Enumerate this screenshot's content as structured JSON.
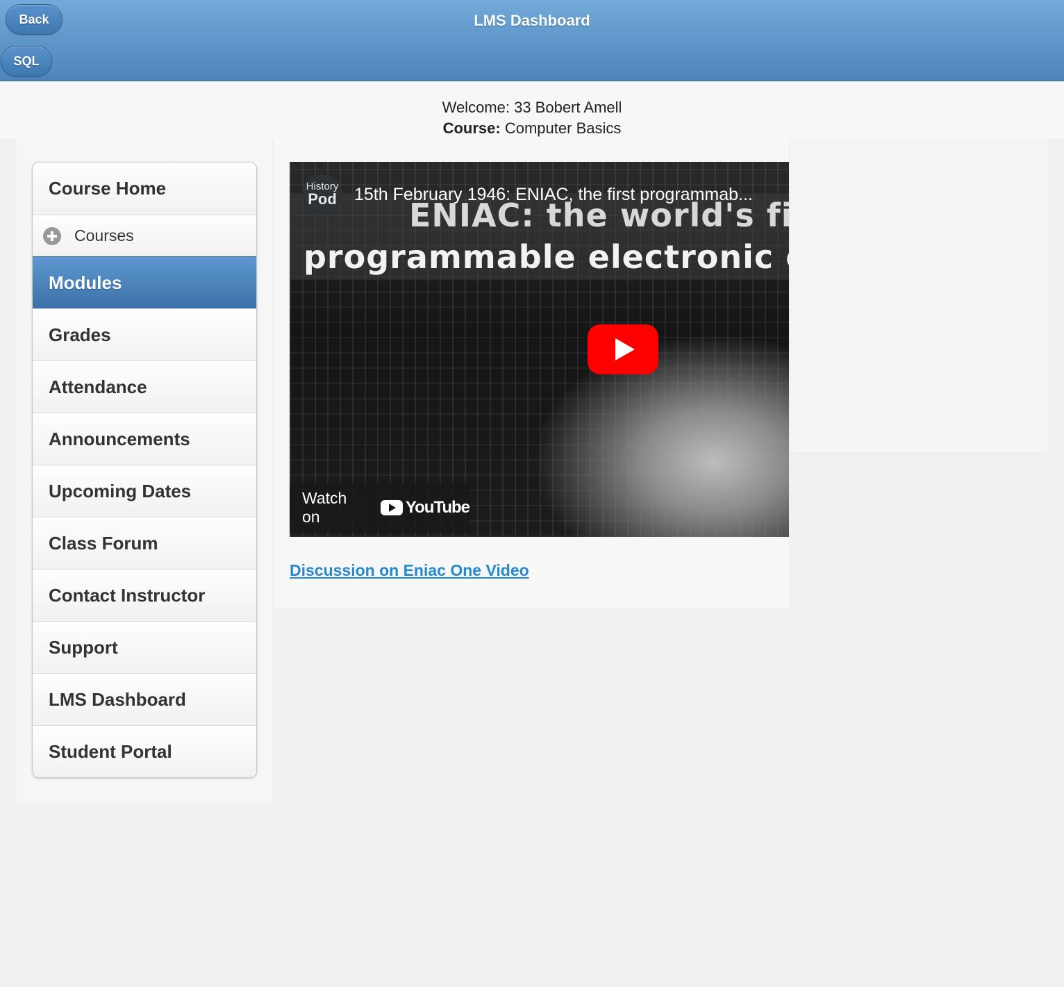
{
  "header": {
    "title": "LMS Dashboard",
    "back_label": "Back",
    "sql_label": "SQL"
  },
  "welcome": {
    "line": "Welcome: 33 Bobert Amell",
    "course_label": "Course:",
    "course_name": "Computer Basics"
  },
  "nav": {
    "items": [
      {
        "label": "Course Home"
      },
      {
        "label": "Courses",
        "icon": "plus-circle-icon"
      },
      {
        "label": "Modules",
        "active": true
      },
      {
        "label": "Grades"
      },
      {
        "label": "Attendance"
      },
      {
        "label": "Announcements"
      },
      {
        "label": "Upcoming Dates"
      },
      {
        "label": "Class Forum"
      },
      {
        "label": "Contact Instructor"
      },
      {
        "label": "Support"
      },
      {
        "label": "LMS Dashboard"
      },
      {
        "label": "Student Portal"
      }
    ]
  },
  "video": {
    "channel_logo_line1": "History",
    "channel_logo_line2": "Pod",
    "title": "15th February 1946: ENIAC, the first programmab...",
    "overlay_line1": "ENIAC: the world's fir",
    "overlay_line2": "programmable electronic c",
    "watch_on": "Watch on",
    "youtube_label": "YouTube",
    "play_color": "#ff0000"
  },
  "discussion_link": "Discussion on Eniac One Video",
  "colors": {
    "header_top": "#72aad9",
    "header_bottom": "#4d84bb",
    "active_nav": "#3b71a8",
    "link": "#2489ce"
  }
}
